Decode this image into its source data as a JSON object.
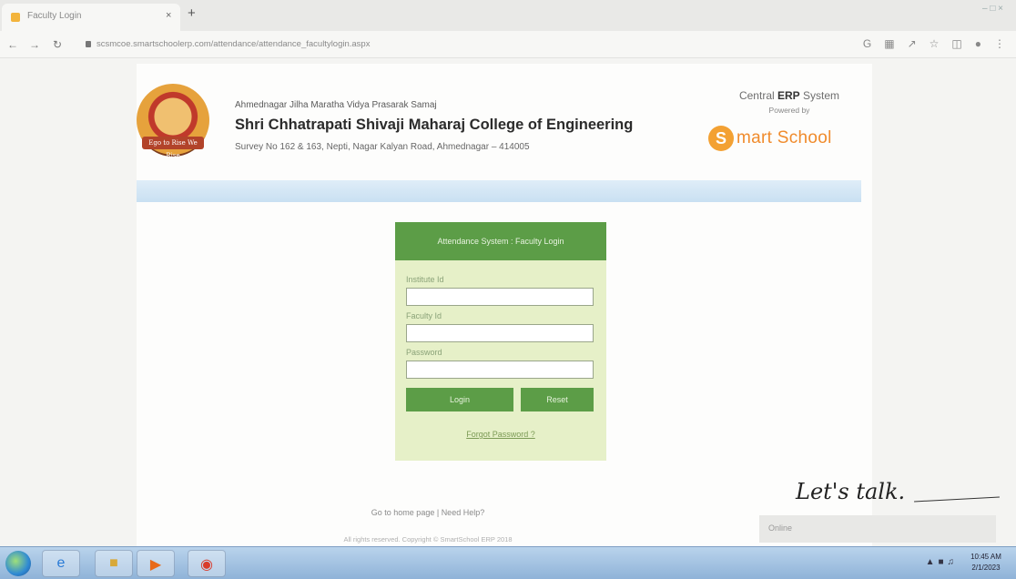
{
  "browser": {
    "tab_title": "Faculty Login",
    "tab_close": "×",
    "new_tab": "+",
    "url": "scsmcoe.smartschoolerp.com/attendance/attendance_facultylogin.aspx",
    "window_controls": "– □ ×"
  },
  "header": {
    "org_name": "Ahmednagar Jilha Maratha Vidya Prasarak Samaj",
    "college_name": "Shri Chhatrapati Shivaji Maharaj College of Engineering",
    "address": "Survey No 162 & 163, Nepti, Nagar Kalyan Road, Ahmednagar – 414005",
    "logo_banner": "Ego to Rise We Rise",
    "erp_prefix": "Central ",
    "erp_bold": "ERP",
    "erp_suffix": " System",
    "powered_by": "Powered by",
    "brand_letter": "S",
    "brand_text": "mart School",
    "brand_color": "#f08b2c"
  },
  "login": {
    "title": "Attendance System : Faculty Login",
    "institute_label": "Institute Id",
    "institute_value": "",
    "faculty_label": "Faculty Id",
    "faculty_value": "",
    "password_label": "Password",
    "password_value": "",
    "login_button": "Login",
    "reset_button": "Reset",
    "forgot_link": "Forgot Password ?",
    "accent_color": "#5c9d47",
    "panel_color": "#e6f0c8"
  },
  "footer": {
    "home_link": "Go to home page",
    "separator": " | ",
    "help_link": "Need Help?",
    "copyright": "All rights reserved. Copyright © SmartSchool ERP 2018"
  },
  "chat": {
    "title": "Let's talk.",
    "status": "Online"
  },
  "taskbar": {
    "clock_time": "10:45 AM",
    "clock_date": "2/1/2023",
    "apps": [
      "explorer-icon",
      "ie-icon",
      "folder-icon",
      "media-player-icon",
      "chrome-icon"
    ]
  }
}
